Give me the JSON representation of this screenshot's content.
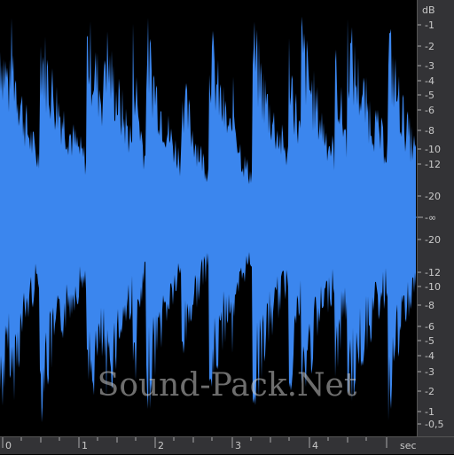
{
  "colors": {
    "waveform": "#3b86ee",
    "background": "#000000",
    "ruler_bg": "#333336",
    "ruler_text": "#c9c9c9"
  },
  "watermark": "Sound-Pack.Net",
  "db_ruler": {
    "unit": "dB",
    "upper_labels": [
      "-1",
      "-2",
      "-3",
      "-4",
      "-5",
      "-6",
      "-8",
      "-10",
      "-12",
      "-20"
    ],
    "center_label": "-∞",
    "lower_labels": [
      "-20",
      "-12",
      "-10",
      "-8",
      "-6",
      "-5",
      "-4",
      "-3",
      "-2",
      "-1",
      "-0,5"
    ]
  },
  "time_ruler": {
    "unit": "sec",
    "labels": [
      "0",
      "1",
      "2",
      "3",
      "4"
    ]
  }
}
